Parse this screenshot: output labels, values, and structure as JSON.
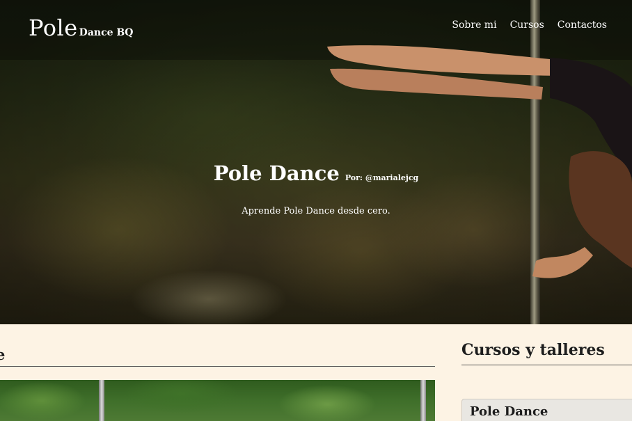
{
  "brand": {
    "primary": "Pole",
    "secondary": "Dance BQ"
  },
  "nav": {
    "items": [
      {
        "label": "Sobre mi"
      },
      {
        "label": "Cursos"
      },
      {
        "label": "Contactos"
      }
    ]
  },
  "hero": {
    "title": "Pole Dance",
    "byline": "Por: @marialejcg",
    "subtitle": "Aprende Pole Dance desde cero."
  },
  "main": {
    "heading_visible": "nce"
  },
  "sidebar": {
    "heading": "Cursos y talleres",
    "courses": [
      {
        "title": "Pole Dance"
      }
    ]
  },
  "colors": {
    "background": "#fdf3e4",
    "nav_text": "#ffffff",
    "heading_text": "#1d1d1d"
  }
}
